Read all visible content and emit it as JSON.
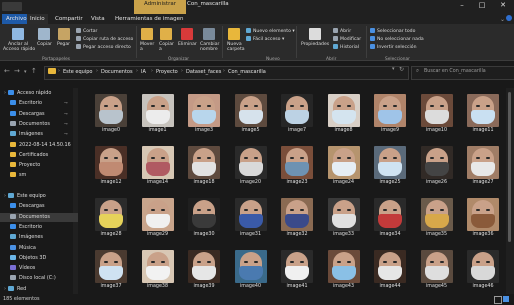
{
  "window": {
    "title": "Con_mascarilla",
    "context_tab": "Administrar",
    "minimize_icon": "minimize-icon",
    "maximize_icon": "maximize-icon",
    "close_icon": "close-icon"
  },
  "tabs": [
    "Archivo",
    "Inicio",
    "Compartir",
    "Vista",
    "Herramientas de imagen"
  ],
  "ribbon": {
    "pin_quick": "Anclar al\nAcceso rápido",
    "copy": "Copiar",
    "paste": "Pegar",
    "cut": "Cortar",
    "copy_path": "Copiar ruta de acceso",
    "paste_shortcut": "Pegar acceso directo",
    "group_clipboard": "Portapapeles",
    "move_to": "Mover\na",
    "copy_to": "Copiar\na",
    "delete": "Eliminar",
    "rename": "Cambiar\nnombre",
    "group_organize": "Organizar",
    "new_folder": "Nueva\ncarpeta",
    "new_item": "Nuevo elemento",
    "easy_access": "Fácil acceso",
    "group_new": "Nuevo",
    "properties": "Propiedades",
    "open": "Abrir",
    "edit": "Modificar",
    "history": "Historial",
    "group_open": "Abrir",
    "select_all": "Seleccionar todo",
    "select_none": "No seleccionar nada",
    "invert": "Invertir selección",
    "group_select": "Seleccionar"
  },
  "address": {
    "crumbs": [
      "Este equipo",
      "Documentos",
      "IA",
      "Proyecto",
      "Dataset_faces",
      "Con_mascarilla"
    ],
    "search_placeholder": "Buscar en Con_mascarilla"
  },
  "nav": [
    {
      "label": "Acceso rápido",
      "icon": "star-icon",
      "color": "#3b8eea",
      "pin": false,
      "indent": 0
    },
    {
      "label": "Escritorio",
      "icon": "desktop-icon",
      "color": "#3b8eea",
      "pin": true,
      "indent": 1
    },
    {
      "label": "Descargas",
      "icon": "download-icon",
      "color": "#3b8eea",
      "pin": true,
      "indent": 1
    },
    {
      "label": "Documentos",
      "icon": "document-icon",
      "color": "#9aa4b0",
      "pin": true,
      "indent": 1
    },
    {
      "label": "Imágenes",
      "icon": "picture-icon",
      "color": "#5fa8d3",
      "pin": true,
      "indent": 1
    },
    {
      "label": "2022-08-14 14.50.16",
      "icon": "folder-icon",
      "color": "#e8b73b",
      "pin": false,
      "indent": 1
    },
    {
      "label": "Certificados",
      "icon": "folder-icon",
      "color": "#e8b73b",
      "pin": false,
      "indent": 1
    },
    {
      "label": "Proyecto",
      "icon": "folder-icon",
      "color": "#e8b73b",
      "pin": false,
      "indent": 1
    },
    {
      "label": "sm",
      "icon": "folder-icon",
      "color": "#e8b73b",
      "pin": false,
      "indent": 1
    },
    {
      "label": "",
      "icon": "",
      "color": "",
      "pin": false,
      "indent": 0
    },
    {
      "label": "Este equipo",
      "icon": "computer-icon",
      "color": "#5fa8d3",
      "pin": false,
      "indent": 0
    },
    {
      "label": "Descargas",
      "icon": "download-icon",
      "color": "#3b8eea",
      "pin": false,
      "indent": 1
    },
    {
      "label": "Documentos",
      "icon": "document-icon",
      "color": "#9aa4b0",
      "pin": false,
      "indent": 1,
      "selected": true
    },
    {
      "label": "Escritorio",
      "icon": "desktop-icon",
      "color": "#3b8eea",
      "pin": false,
      "indent": 1
    },
    {
      "label": "Imágenes",
      "icon": "picture-icon",
      "color": "#5fa8d3",
      "pin": false,
      "indent": 1
    },
    {
      "label": "Música",
      "icon": "music-icon",
      "color": "#4a90e2",
      "pin": false,
      "indent": 1
    },
    {
      "label": "Objetos 3D",
      "icon": "cube-icon",
      "color": "#6cb6e8",
      "pin": false,
      "indent": 1
    },
    {
      "label": "Vídeos",
      "icon": "video-icon",
      "color": "#7a6fd6",
      "pin": false,
      "indent": 1
    },
    {
      "label": "Disco local (C:)",
      "icon": "drive-icon",
      "color": "#9aa4b0",
      "pin": false,
      "indent": 1
    },
    {
      "label": "Red",
      "icon": "network-icon",
      "color": "#5fa8d3",
      "pin": false,
      "indent": 0
    }
  ],
  "files": [
    [
      "image0",
      "image1",
      "image3",
      "image5",
      "image7",
      "image8",
      "image9",
      "image10",
      "image11"
    ],
    [
      "image12",
      "image14",
      "image18",
      "image20",
      "image23",
      "image24",
      "image25",
      "image26",
      "image27"
    ],
    [
      "image28",
      "image29",
      "image30",
      "image31",
      "image32",
      "image33",
      "image34",
      "image35",
      "image36"
    ],
    [
      "image37",
      "image38",
      "image39",
      "image40",
      "image41",
      "image43",
      "image44",
      "image45",
      "image46"
    ]
  ],
  "thumb_colors": [
    [
      [
        "#4a4038",
        "#b8c3cc"
      ],
      [
        "#c7c3bd",
        "#ececec"
      ],
      [
        "#c49a86",
        "#b8d6ec"
      ],
      [
        "#5d4a3e",
        "#d6e2ec"
      ],
      [
        "#262626",
        "#bcd2e4"
      ],
      [
        "#d8cfc6",
        "#d4e4ef"
      ],
      [
        "#b0846a",
        "#9fc4e8"
      ],
      [
        "#6b4a3a",
        "#dcdcdc"
      ],
      [
        "#8a6a5a",
        "#c9e0f2"
      ]
    ],
    [
      [
        "#4a2f26",
        "#c08a72"
      ],
      [
        "#d7c7b4",
        "#b05a62"
      ],
      [
        "#5e4a3e",
        "#e2e2e2"
      ],
      [
        "#2a2a2a",
        "#d9d9d9"
      ],
      [
        "#7a4e3a",
        "#6e92b2"
      ],
      [
        "#b6946e",
        "#e6eef5"
      ],
      [
        "#5a6a7a",
        "#cfe3f2"
      ],
      [
        "#312a26",
        "#444444"
      ],
      [
        "#a07d66",
        "#e8e8e8"
      ]
    ],
    [
      [
        "#2b2b2b",
        "#e6d25a"
      ],
      [
        "#c9a58c",
        "#f0f0f0"
      ],
      [
        "#1f1f1f",
        "#3a3a3a"
      ],
      [
        "#2a2a2a",
        "#3a5aa8"
      ],
      [
        "#8a6a52",
        "#3a4a8a"
      ],
      [
        "#3a3a3a",
        "#e0e0e0"
      ],
      [
        "#2a2a2a",
        "#c23a3a"
      ],
      [
        "#6a5a4a",
        "#d8a84a"
      ],
      [
        "#b08a6a",
        "#8a5a3a"
      ]
    ],
    [
      [
        "#4a3a30",
        "#cfe2f2"
      ],
      [
        "#d8c7b4",
        "#f2f2f2"
      ],
      [
        "#3a2a22",
        "#e6e6e6"
      ],
      [
        "#3a6a8a",
        "#4a7ab0"
      ],
      [
        "#2a2a2a",
        "#f0f0f0"
      ],
      [
        "#6a4a3a",
        "#8ac0e6"
      ],
      [
        "#3a2a22",
        "#e6e6e6"
      ],
      [
        "#5a4a3e",
        "#dedede"
      ],
      [
        "#2a2a2a",
        "#d8d8d8"
      ]
    ]
  ],
  "status": {
    "count": "185 elementos"
  }
}
